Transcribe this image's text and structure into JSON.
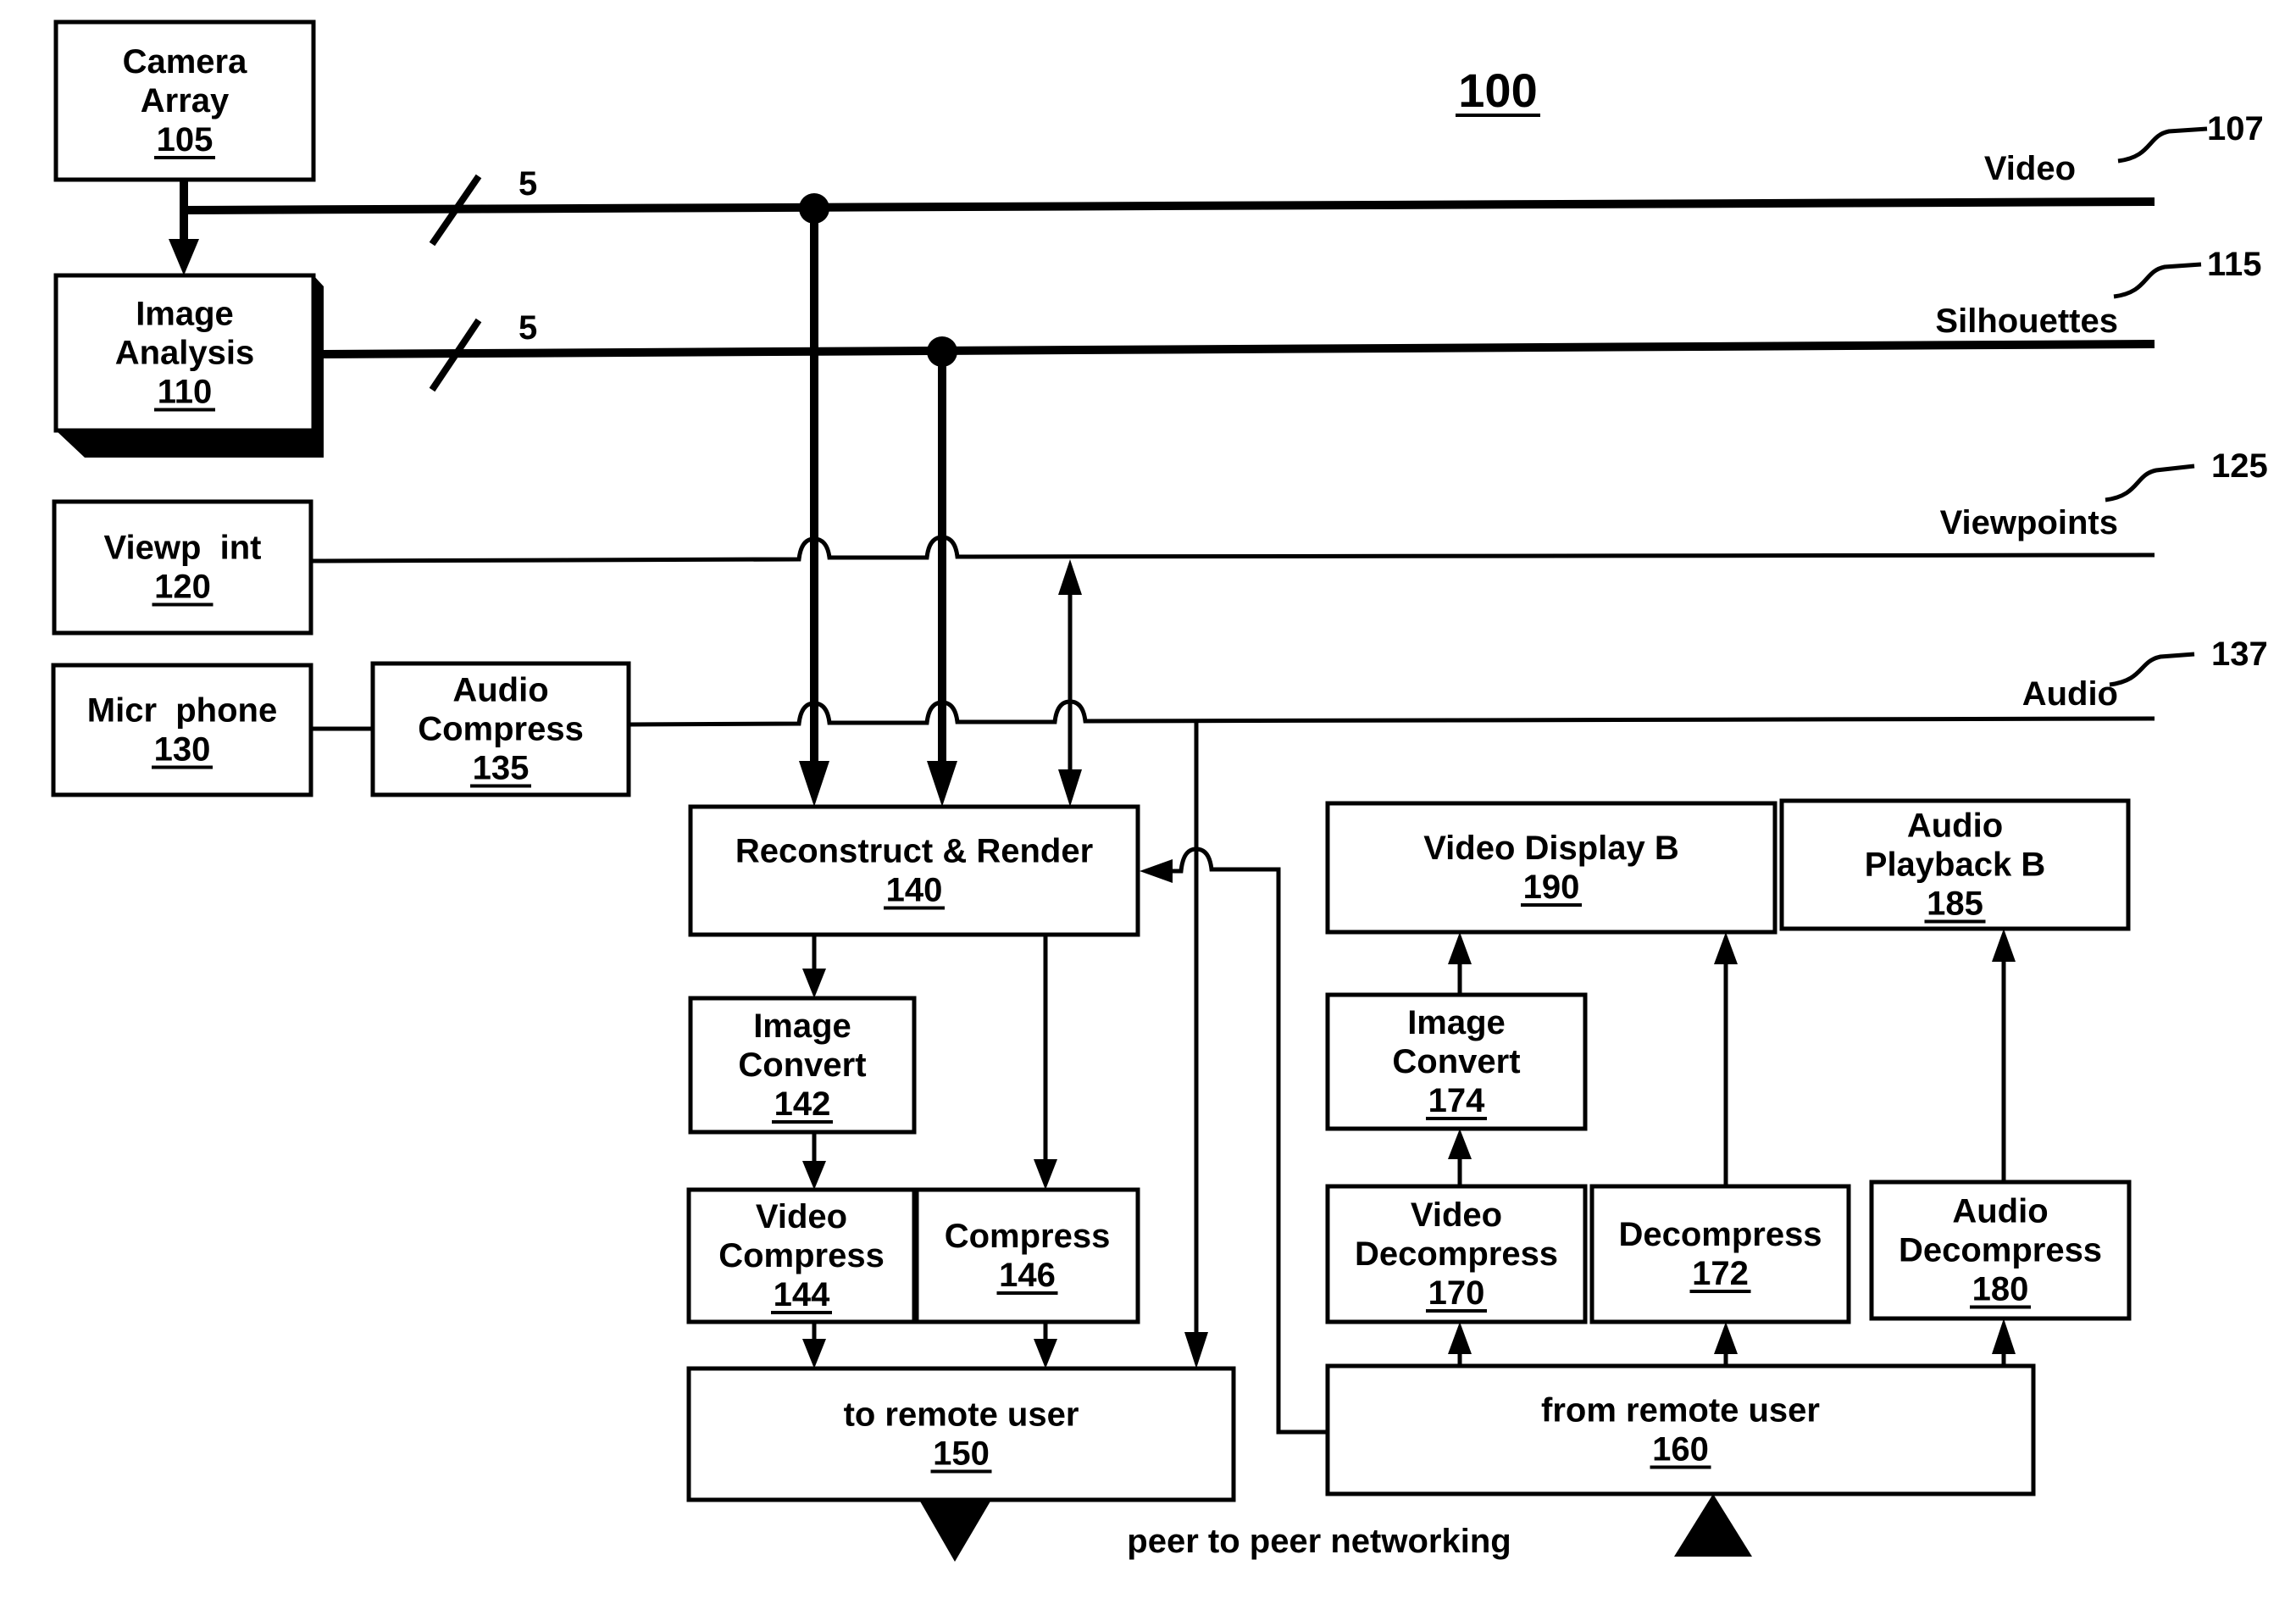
{
  "figure": {
    "number": "100",
    "boxes": {
      "camera_array": {
        "lines": [
          "Camera",
          "Array"
        ],
        "ref": "105"
      },
      "image_analysis": {
        "lines": [
          "Image",
          "Analysis"
        ],
        "ref": "110"
      },
      "viewpoint": {
        "lines": [
          "Viewp  int"
        ],
        "ref": "120"
      },
      "microphone": {
        "lines": [
          "Micr  phone"
        ],
        "ref": "130"
      },
      "audio_compress": {
        "lines": [
          "Audio",
          "Compress"
        ],
        "ref": "135"
      },
      "reconstruct_render": {
        "lines": [
          "Reconstruct & Render"
        ],
        "ref": "140"
      },
      "image_convert_a": {
        "lines": [
          "Image",
          "Convert"
        ],
        "ref": "142"
      },
      "video_compress": {
        "lines": [
          "Video",
          "Compress"
        ],
        "ref": "144"
      },
      "compress": {
        "lines": [
          "Compress"
        ],
        "ref": "146"
      },
      "to_remote_user": {
        "lines": [
          "to remote user"
        ],
        "ref": "150"
      },
      "from_remote_user": {
        "lines": [
          "from remote user"
        ],
        "ref": "160"
      },
      "video_decompress": {
        "lines": [
          "Video",
          "Decompress"
        ],
        "ref": "170"
      },
      "decompress": {
        "lines": [
          "Decompress"
        ],
        "ref": "172"
      },
      "image_convert_b": {
        "lines": [
          "Image",
          "Convert"
        ],
        "ref": "174"
      },
      "audio_decompress": {
        "lines": [
          "Audio",
          "Decompress"
        ],
        "ref": "180"
      },
      "audio_playback_b": {
        "lines": [
          "Audio",
          "Playback B"
        ],
        "ref": "185"
      },
      "video_display_b": {
        "lines": [
          "Video Display B"
        ],
        "ref": "190"
      }
    },
    "buses": {
      "video": {
        "label": "Video",
        "ref": "107",
        "width_marker": "5"
      },
      "silhouettes": {
        "label": "Silhouettes",
        "ref": "115",
        "width_marker": "5"
      },
      "viewpoints": {
        "label": "Viewpoints",
        "ref": "125"
      },
      "audio": {
        "label": "Audio",
        "ref": "137"
      }
    },
    "network_label": "peer to peer networking"
  }
}
